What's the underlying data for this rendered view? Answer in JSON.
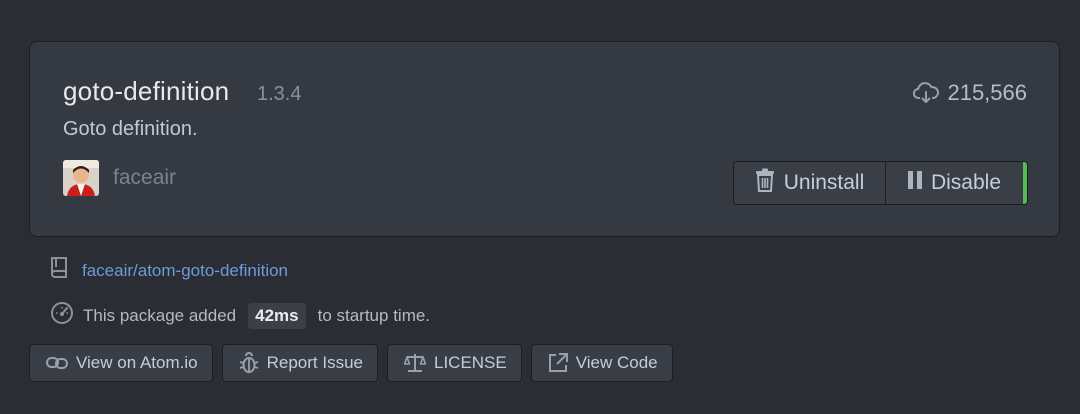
{
  "package": {
    "name": "goto-definition",
    "version": "1.3.4",
    "description": "Goto definition.",
    "downloads": "215,566",
    "author": "faceair"
  },
  "actions": {
    "uninstall_label": "Uninstall",
    "disable_label": "Disable",
    "enabled_color": "#55bb55"
  },
  "meta": {
    "repo": "faceair/atom-goto-definition",
    "startup_prefix": "This package added",
    "startup_value": "42ms",
    "startup_suffix": "to startup time."
  },
  "footer": {
    "view_atom": "View on Atom.io",
    "report_issue": "Report Issue",
    "license": "LICENSE",
    "view_code": "View Code"
  },
  "icons": {
    "downloads": "cloud-download-icon",
    "uninstall": "trash-icon",
    "disable": "pause-icon",
    "repo": "book-icon",
    "startup": "dashboard-icon",
    "atom": "link-icon",
    "issue": "bug-icon",
    "license": "law-icon",
    "code": "external-link-icon"
  }
}
